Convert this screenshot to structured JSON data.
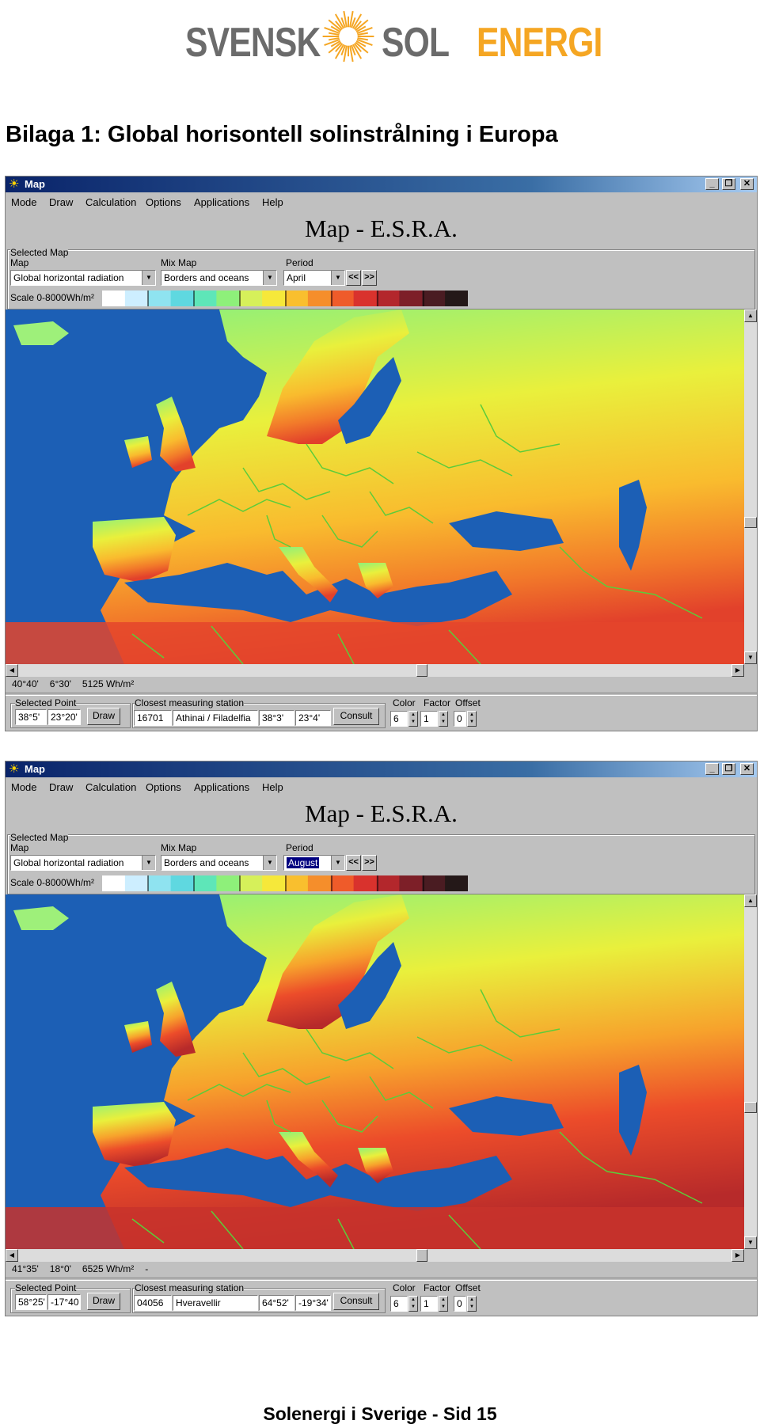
{
  "logo": {
    "svensk": "SVENSK",
    "sol": "SOL",
    "energi": "ENERGI"
  },
  "heading": "Bilaga 1:  Global horisontell solinstrålning i Europa",
  "footer": "Solenergi i Sverige - Sid 15",
  "colors": {
    "ocean": "#1c5fb5",
    "titlebar": "#0a246a",
    "window": "#c0c0c0",
    "borders": "#5ccc3a",
    "logo_orange": "#f5a623",
    "logo_grey": "#6b6b6b"
  },
  "window_common": {
    "title": "Map",
    "menu": [
      "Mode",
      "Draw",
      "Calculation",
      "Options",
      "Applications",
      "Help"
    ],
    "app_title": "Map - E.S.R.A.",
    "group_label": "Selected Map",
    "map_label": "Map",
    "mix_label": "Mix Map",
    "period_label": "Period",
    "map_value": "Global horizontal radiation",
    "mix_value": "Borders and oceans",
    "scale_label": "Scale 0-8000Wh/m²",
    "prev": "<<",
    "next": ">>",
    "selected_point_label": "Selected Point",
    "draw_button": "Draw",
    "station_label": "Closest measuring station",
    "consult_button": "Consult",
    "color_label": "Color",
    "factor_label": "Factor",
    "offset_label": "Offset",
    "color_value": "6",
    "factor_value": "1",
    "offset_value": "0"
  },
  "windows": [
    {
      "period": "April",
      "status_lat": "40°40'",
      "status_lon": "6°30'",
      "status_value": "5125 Wh/m²",
      "status_extra": "",
      "point_lat": "38°5'",
      "point_lon": "23°20'",
      "station_id": "16701",
      "station_name": "Athinai / Filadelfia",
      "station_lat": "38°3'",
      "station_lon": "23°4'"
    },
    {
      "period": "August",
      "status_lat": "41°35'",
      "status_lon": "18°0'",
      "status_value": "6525 Wh/m²",
      "status_extra": "-",
      "point_lat": "58°25'",
      "point_lon": "-17°40",
      "station_id": "04056",
      "station_name": "Hveravellir",
      "station_lat": "64°52'",
      "station_lon": "-19°34'"
    }
  ]
}
